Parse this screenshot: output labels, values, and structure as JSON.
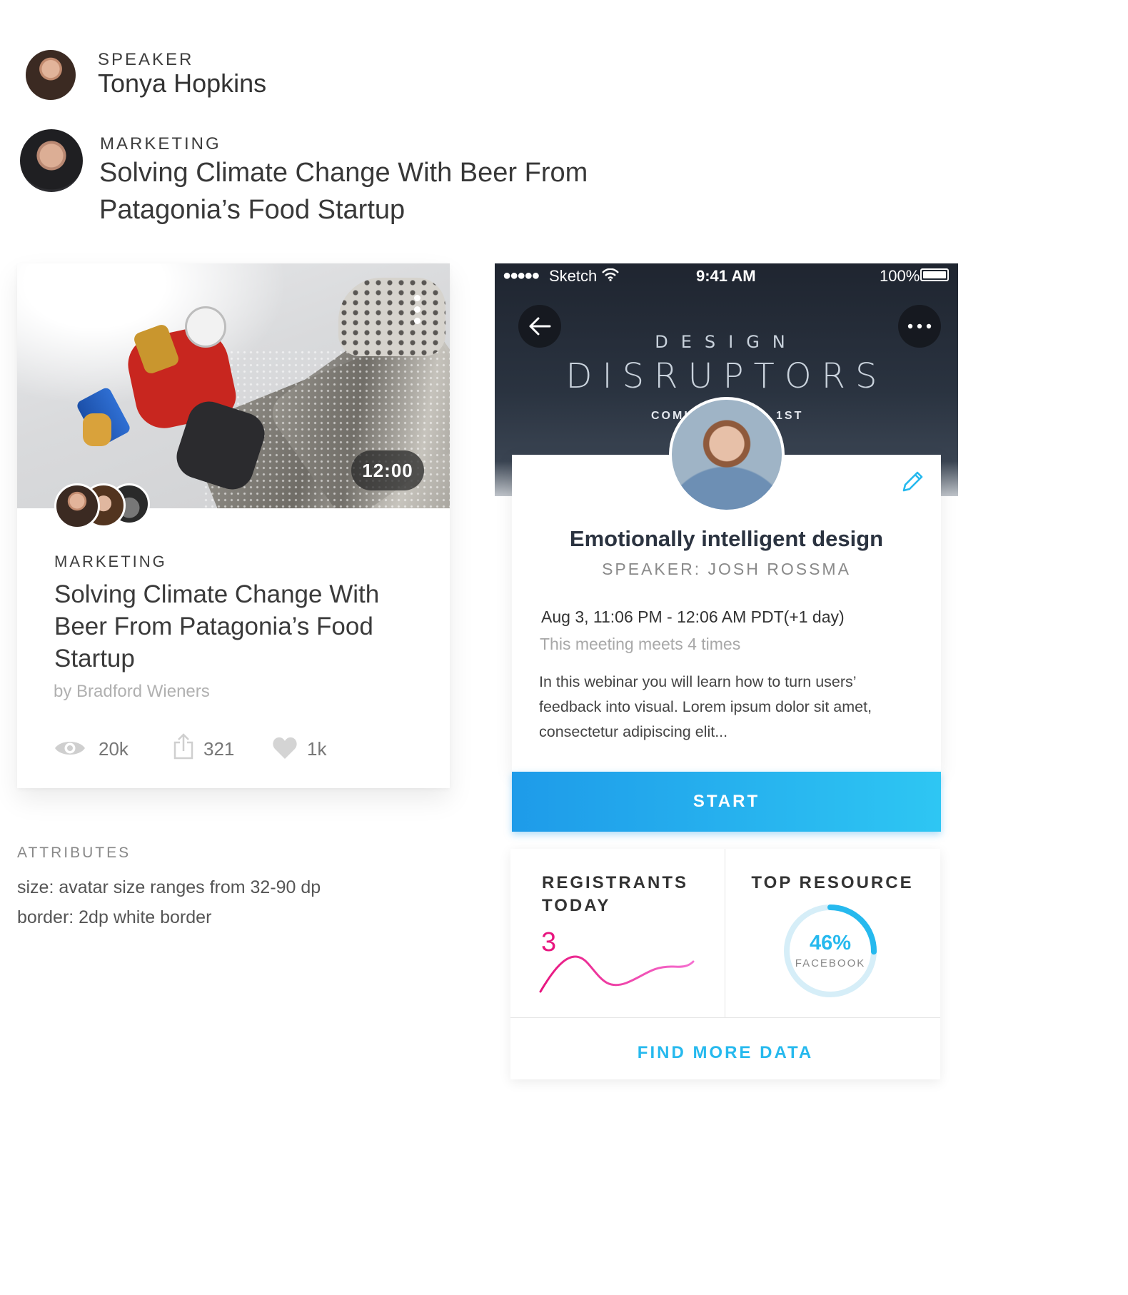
{
  "speaker_row": {
    "kicker": "SPEAKER",
    "name": "Tonya Hopkins"
  },
  "marketing_row": {
    "kicker": "MARKETING",
    "title": "Solving Climate Change With Beer From Patagonia’s Food Startup"
  },
  "article_card": {
    "duration": "12:00",
    "kicker": "MARKETING",
    "title": "Solving Climate Change With Beer From Patagonia’s Food Startup",
    "byline": "by Bradford Wieners",
    "views": "20k",
    "shares": "321",
    "likes": "1k"
  },
  "attributes": {
    "heading": "ATTRIBUTES",
    "line1": "size: avatar size ranges from 32-90 dp",
    "line2": "border: 2dp white border"
  },
  "phone": {
    "carrier": "Sketch",
    "time": "9:41 AM",
    "battery": "100%",
    "banner_top": "DESIGN",
    "banner_main": "DISRUPTORS",
    "banner_sub_left": "COMI",
    "banner_sub_right": "1ST"
  },
  "event": {
    "title": "Emotionally intelligent design",
    "speaker": "SPEAKER: JOSH ROSSMA",
    "datetime": "Aug 3, 11:06 PM - 12:06 AM PDT(+1 day)",
    "recurrence": "This meeting meets 4 times",
    "description": "In this webinar you will learn how to turn users’ feedback into visual. Lorem ipsum dolor sit amet, consectetur adipiscing elit...",
    "start_label": "START"
  },
  "stats": {
    "registrants_label": "REGISTRANTS TODAY",
    "registrants_value": "3",
    "top_resource_label": "TOP RESOURCE",
    "percent": "46%",
    "percent_value": 0.46,
    "resource_name": "FACEBOOK",
    "find_more": "FIND MORE DATA"
  },
  "colors": {
    "accent_blue": "#26b9ee",
    "pink": "#e8157f"
  }
}
